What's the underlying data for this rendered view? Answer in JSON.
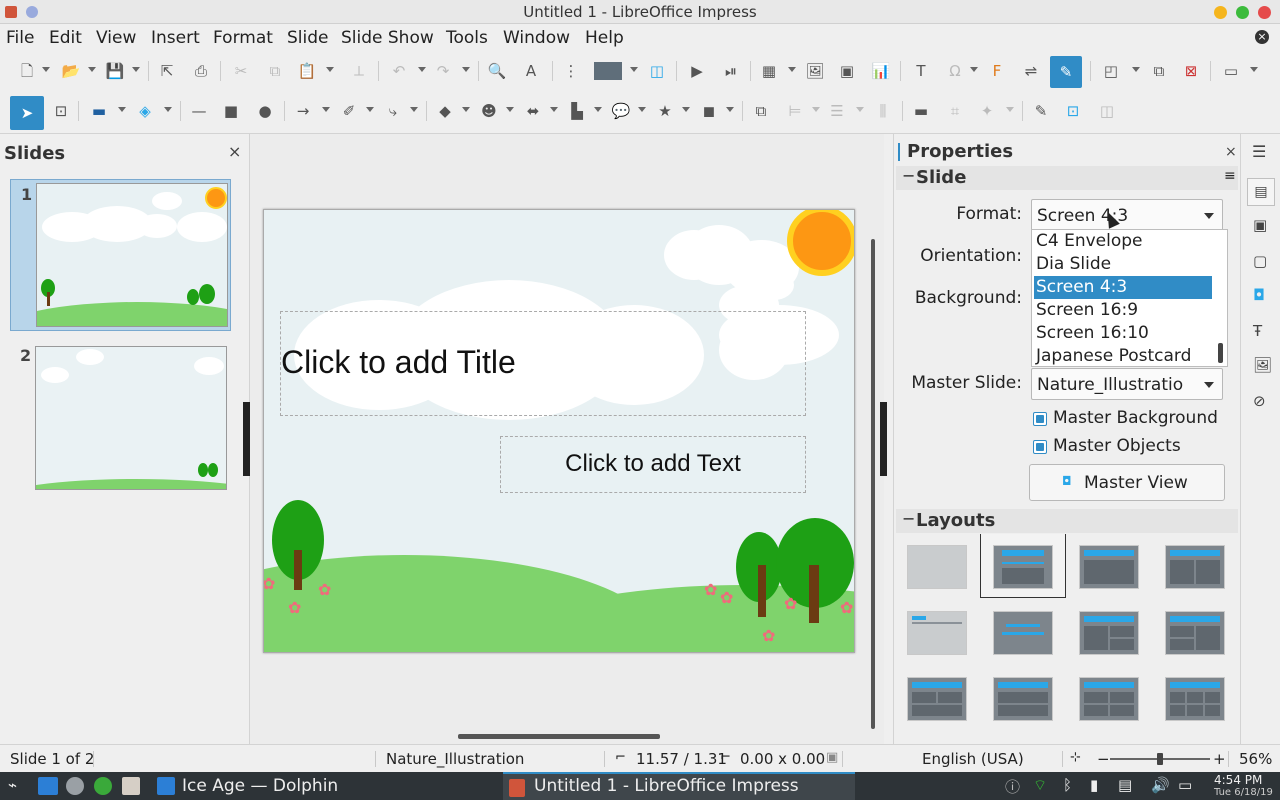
{
  "window": {
    "title": "Untitled 1 - LibreOffice Impress"
  },
  "menu": [
    "File",
    "Edit",
    "View",
    "Insert",
    "Format",
    "Slide",
    "Slide Show",
    "Tools",
    "Window",
    "Help"
  ],
  "slides_panel": {
    "title": "Slides",
    "close": "×",
    "slides": [
      {
        "number": "1"
      },
      {
        "number": "2"
      }
    ]
  },
  "slide": {
    "title_placeholder": "Click to add Title",
    "text_placeholder": "Click to add Text"
  },
  "properties": {
    "title": "Properties",
    "close": "×",
    "section_slide": "Slide",
    "format_label": "Format:",
    "format_value": "Screen 4:3",
    "orientation_label": "Orientation:",
    "background_label": "Background:",
    "master_slide_label": "Master Slide:",
    "master_slide_value": "Nature_Illustratio",
    "master_background": "Master Background",
    "master_objects": "Master Objects",
    "master_view": "Master View",
    "section_layouts": "Layouts",
    "format_options": [
      "C4 Envelope",
      "Dia Slide",
      "Screen 4:3",
      "Screen 16:9",
      "Screen 16:10",
      "Japanese Postcard"
    ],
    "selected_option": "Screen 4:3"
  },
  "statusbar": {
    "slide_of": "Slide 1 of 2",
    "master": "Nature_Illustration",
    "position": "11.57 / 1.31",
    "size": "0.00 x 0.00",
    "language": "English (USA)",
    "zoom": "56%"
  },
  "taskbar": {
    "dolphin": "Ice Age — Dolphin",
    "impress": "Untitled 1 - LibreOffice Impress",
    "time": "4:54 PM",
    "date": "Tue 6/18/19"
  },
  "colors": {
    "accent": "#308cc6",
    "layout_blue": "#2aa7e8",
    "sun": "#fd9713"
  }
}
